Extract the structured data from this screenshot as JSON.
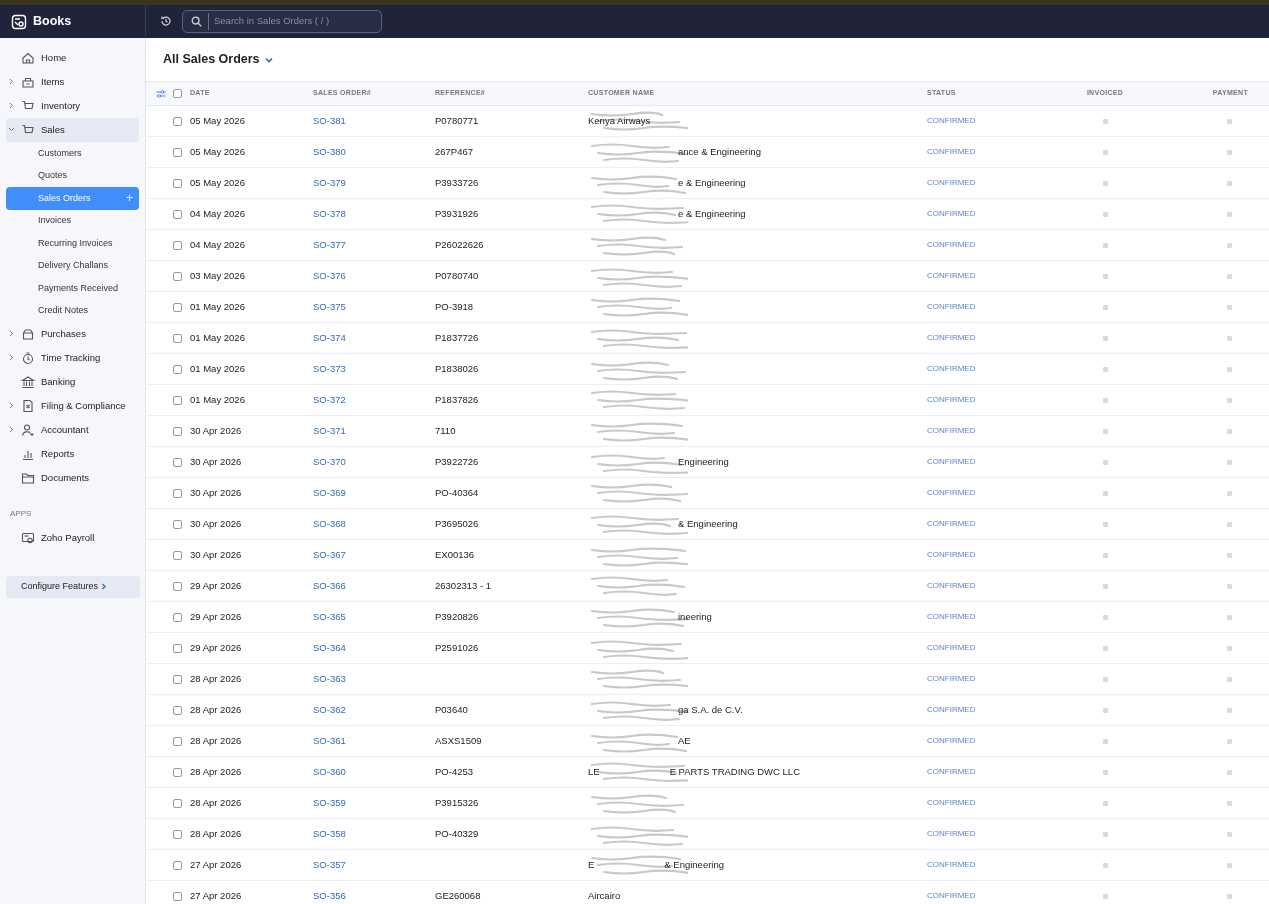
{
  "app": {
    "name": "Books"
  },
  "search": {
    "placeholder": "Search in Sales Orders ( / )"
  },
  "sidebar": {
    "items": [
      {
        "label": "Home",
        "expandable": false,
        "expanded": false
      },
      {
        "label": "Items",
        "expandable": true,
        "expanded": false
      },
      {
        "label": "Inventory",
        "expandable": true,
        "expanded": false
      },
      {
        "label": "Sales",
        "expandable": true,
        "expanded": true,
        "children": [
          {
            "label": "Customers",
            "selected": false
          },
          {
            "label": "Quotes",
            "selected": false
          },
          {
            "label": "Sales Orders",
            "selected": true,
            "add": "+"
          },
          {
            "label": "Invoices",
            "selected": false
          },
          {
            "label": "Recurring Invoices",
            "selected": false
          },
          {
            "label": "Delivery Challans",
            "selected": false
          },
          {
            "label": "Payments Received",
            "selected": false
          },
          {
            "label": "Credit Notes",
            "selected": false
          }
        ]
      },
      {
        "label": "Purchases",
        "expandable": true,
        "expanded": false
      },
      {
        "label": "Time Tracking",
        "expandable": true,
        "expanded": false
      },
      {
        "label": "Banking",
        "expandable": false,
        "expanded": false
      },
      {
        "label": "Filing & Compliance",
        "expandable": true,
        "expanded": false
      },
      {
        "label": "Accountant",
        "expandable": true,
        "expanded": false
      },
      {
        "label": "Reports",
        "expandable": false,
        "expanded": false
      },
      {
        "label": "Documents",
        "expandable": false,
        "expanded": false
      }
    ],
    "apps_heading": "APPS",
    "apps": [
      {
        "label": "Zoho Payroll"
      }
    ],
    "configure": "Configure Features"
  },
  "view": {
    "title": "All Sales Orders"
  },
  "table": {
    "all_selected": false,
    "columns": [
      "DATE",
      "SALES ORDER#",
      "REFERENCE#",
      "CUSTOMER NAME",
      "STATUS",
      "INVOICED",
      "PAYMENT"
    ],
    "rows": [
      {
        "date": "05 May 2026",
        "order": "SO-381",
        "reference": "P0780771",
        "customer": [
          "Kenya Airways"
        ],
        "redacted": true,
        "status": "CONFIRMED",
        "checked": false
      },
      {
        "date": "05 May 2026",
        "order": "SO-380",
        "reference": "267P467",
        "customer": [
          "ance & Engineering"
        ],
        "redacted": true,
        "status": "CONFIRMED",
        "checked": false
      },
      {
        "date": "05 May 2026",
        "order": "SO-379",
        "reference": "P3933726",
        "customer": [
          "e & Engineering"
        ],
        "redacted": true,
        "status": "CONFIRMED",
        "checked": false
      },
      {
        "date": "04 May 2026",
        "order": "SO-378",
        "reference": "P3931926",
        "customer": [
          "e & Engineering"
        ],
        "redacted": true,
        "status": "CONFIRMED",
        "checked": false
      },
      {
        "date": "04 May 2026",
        "order": "SO-377",
        "reference": "P26022626",
        "customer": [],
        "redacted": true,
        "status": "CONFIRMED",
        "checked": false
      },
      {
        "date": "03 May 2026",
        "order": "SO-376",
        "reference": "P0780740",
        "customer": [],
        "redacted": true,
        "status": "CONFIRMED",
        "checked": false
      },
      {
        "date": "01 May 2026",
        "order": "SO-375",
        "reference": "PO-3918",
        "customer": [],
        "redacted": true,
        "status": "CONFIRMED",
        "checked": false
      },
      {
        "date": "01 May 2026",
        "order": "SO-374",
        "reference": "P1837726",
        "customer": [],
        "redacted": true,
        "status": "CONFIRMED",
        "checked": false
      },
      {
        "date": "01 May 2026",
        "order": "SO-373",
        "reference": "P1838026",
        "customer": [],
        "redacted": true,
        "status": "CONFIRMED",
        "checked": false
      },
      {
        "date": "01 May 2026",
        "order": "SO-372",
        "reference": "P1837826",
        "customer": [],
        "redacted": true,
        "status": "CONFIRMED",
        "checked": false
      },
      {
        "date": "30 Apr 2026",
        "order": "SO-371",
        "reference": "7110",
        "customer": [],
        "redacted": true,
        "status": "CONFIRMED",
        "checked": false
      },
      {
        "date": "30 Apr 2026",
        "order": "SO-370",
        "reference": "P3922726",
        "customer": [
          "Engineering"
        ],
        "redacted": true,
        "status": "CONFIRMED",
        "checked": false
      },
      {
        "date": "30 Apr 2026",
        "order": "SO-369",
        "reference": "PO-40364",
        "customer": [],
        "redacted": true,
        "status": "CONFIRMED",
        "checked": false
      },
      {
        "date": "30 Apr 2026",
        "order": "SO-368",
        "reference": "P3695026",
        "customer": [
          "& Engineering"
        ],
        "redacted": true,
        "status": "CONFIRMED",
        "checked": false
      },
      {
        "date": "30 Apr 2026",
        "order": "SO-367",
        "reference": "EX00136",
        "customer": [],
        "redacted": true,
        "status": "CONFIRMED",
        "checked": false
      },
      {
        "date": "29 Apr 2026",
        "order": "SO-366",
        "reference": "26302313 - 1",
        "customer": [],
        "redacted": true,
        "status": "CONFIRMED",
        "checked": false
      },
      {
        "date": "29 Apr 2026",
        "order": "SO-365",
        "reference": "P3920826",
        "customer": [
          "ineering"
        ],
        "redacted": true,
        "status": "CONFIRMED",
        "checked": false
      },
      {
        "date": "29 Apr 2026",
        "order": "SO-364",
        "reference": "P2591026",
        "customer": [],
        "redacted": true,
        "status": "CONFIRMED",
        "checked": false
      },
      {
        "date": "28 Apr 2026",
        "order": "SO-363",
        "reference": "",
        "customer": [],
        "redacted": true,
        "status": "CONFIRMED",
        "checked": false
      },
      {
        "date": "28 Apr 2026",
        "order": "SO-362",
        "reference": "P03640",
        "customer": [
          "ga S.A. de C.V."
        ],
        "redacted": true,
        "status": "CONFIRMED",
        "checked": false
      },
      {
        "date": "28 Apr 2026",
        "order": "SO-361",
        "reference": "ASXS1509",
        "customer": [
          "AE"
        ],
        "redacted": true,
        "status": "CONFIRMED",
        "checked": false
      },
      {
        "date": "28 Apr 2026",
        "order": "SO-360",
        "reference": "PO-4253",
        "customer": [
          "LE",
          "E PARTS TRADING DWC LLC"
        ],
        "redacted": true,
        "status": "CONFIRMED",
        "checked": false
      },
      {
        "date": "28 Apr 2026",
        "order": "SO-359",
        "reference": "P3915326",
        "customer": [],
        "redacted": true,
        "status": "CONFIRMED",
        "checked": false
      },
      {
        "date": "28 Apr 2026",
        "order": "SO-358",
        "reference": "PO-40329",
        "customer": [],
        "redacted": true,
        "status": "CONFIRMED",
        "checked": false
      },
      {
        "date": "27 Apr 2026",
        "order": "SO-357",
        "reference": "",
        "customer": [
          "E",
          "& Engineering"
        ],
        "redacted": true,
        "status": "CONFIRMED",
        "checked": false
      },
      {
        "date": "27 Apr 2026",
        "order": "SO-356",
        "reference": "GE260068",
        "customer": [
          "Aircairo"
        ],
        "redacted": false,
        "status": "CONFIRMED",
        "checked": false
      }
    ]
  }
}
